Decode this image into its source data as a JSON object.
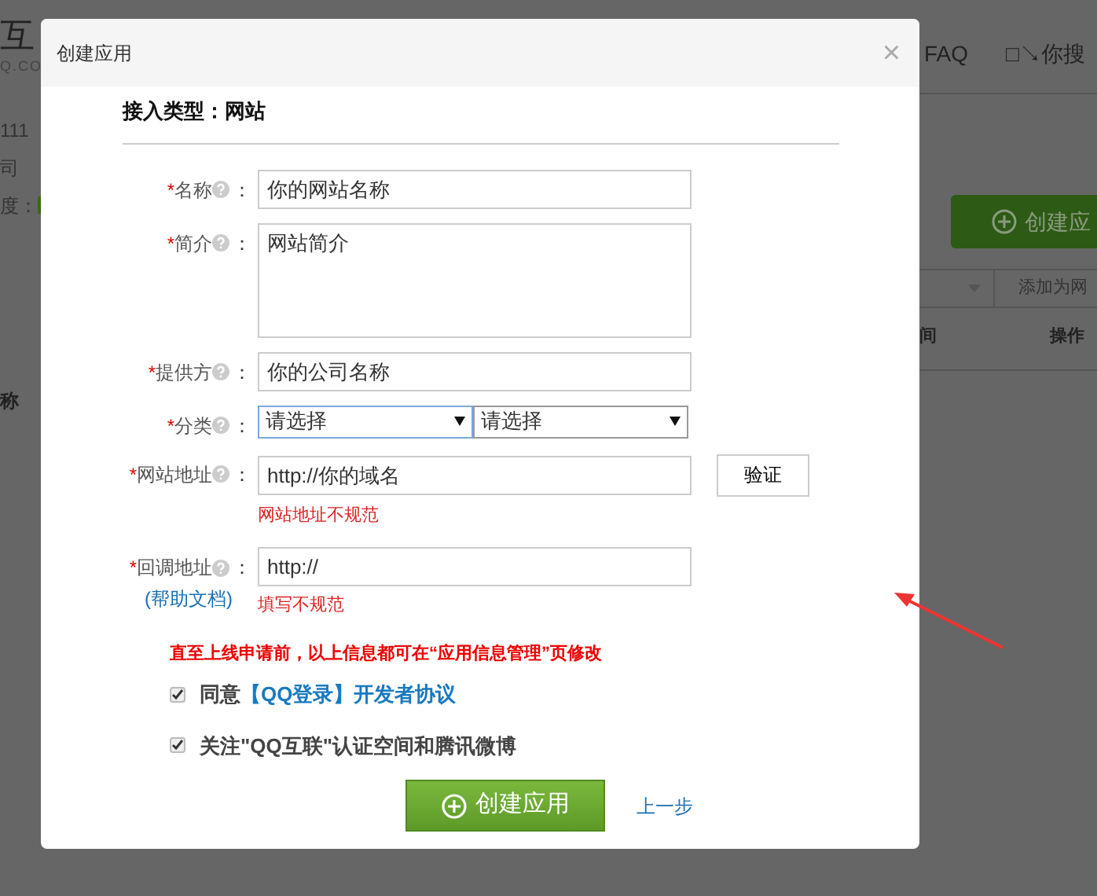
{
  "background": {
    "logo": "互",
    "logo_domain": "Q.CO",
    "left_texts": [
      "111",
      "司",
      "度："
    ],
    "left_column": "称",
    "nav": [
      "FAQ",
      "□↘你搜"
    ],
    "create_button": "创建应",
    "filter_button": "添加为网",
    "right_columns": [
      "间",
      "操作"
    ]
  },
  "modal": {
    "title": "创建应用",
    "close": "×",
    "type_label": "接入类型：网站",
    "fields": [
      {
        "kind": "text",
        "marker": "*",
        "label": "名称",
        "colon": "：",
        "value": "你的网站名称"
      },
      {
        "kind": "textarea",
        "marker": "*",
        "label": "简介",
        "colon": "：",
        "value": "网站简介"
      },
      {
        "kind": "text",
        "marker": "*",
        "label": "提供方",
        "colon": "：",
        "value": "你的公司名称"
      },
      {
        "kind": "select",
        "marker": "*",
        "label": "分类",
        "colon": "：",
        "selects": [
          {
            "value": "请选择",
            "focused": true
          },
          {
            "value": "请选择",
            "focused": false
          }
        ]
      },
      {
        "kind": "text",
        "marker": "*",
        "label": "网站地址",
        "colon": "：",
        "value": "http://你的域名",
        "button": "验证",
        "error": "网站地址不规范"
      },
      {
        "kind": "text",
        "marker": "*",
        "label": "回调地址",
        "colon": "：",
        "value": "http://",
        "help_link": "(帮助文档)",
        "error": "填写不规范"
      }
    ],
    "notice": "直至上线申请前，以上信息都可在“应用信息管理”页修改",
    "checkboxes": [
      {
        "text": "同意",
        "link": "【QQ登录】开发者协议",
        "checked": true
      },
      {
        "text": "关注\"QQ互联\"认证空间和腾讯微博",
        "checked": true
      }
    ],
    "submit": "创建应用",
    "back": "上一步"
  }
}
